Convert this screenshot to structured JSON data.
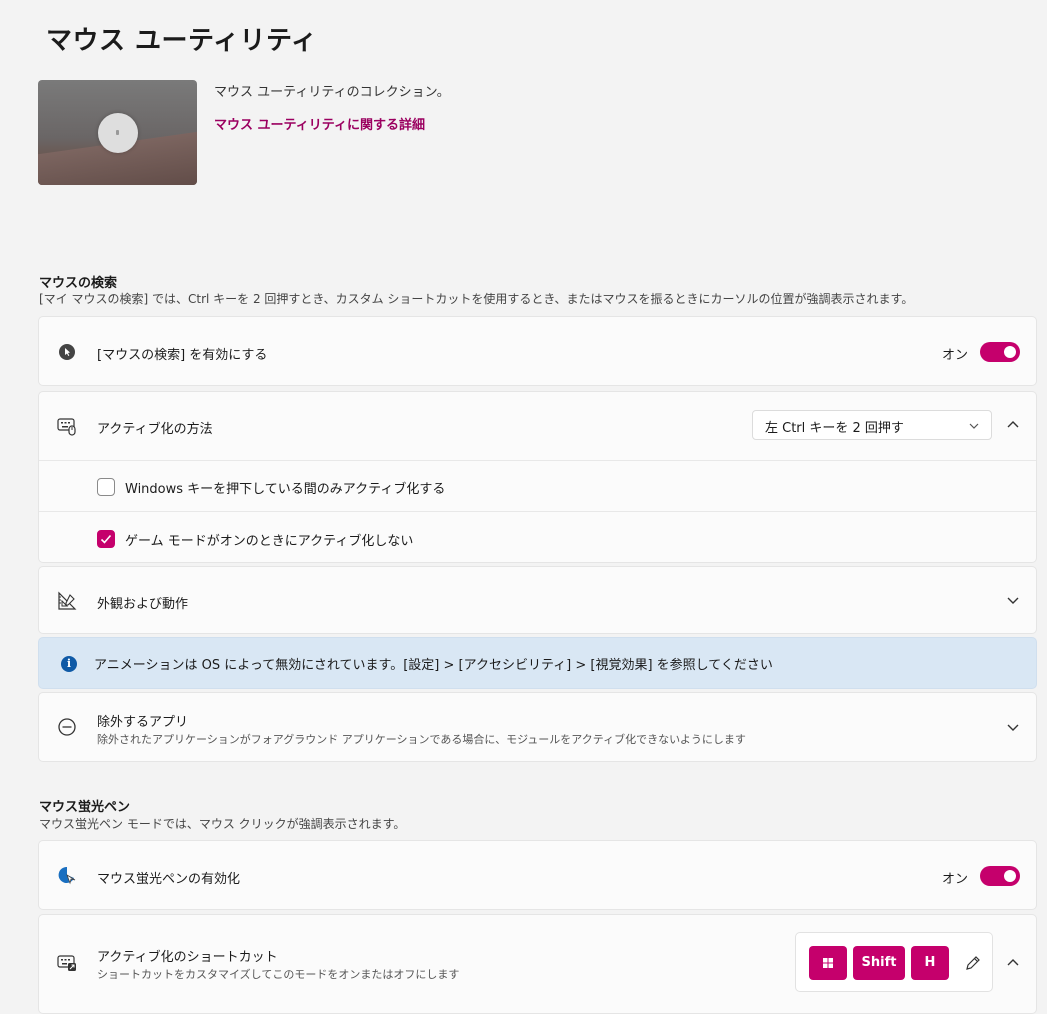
{
  "page": {
    "title": "マウス ユーティリティ"
  },
  "hero": {
    "description": "マウス ユーティリティのコレクション。",
    "link": "マウス ユーティリティに関する詳細"
  },
  "find_mouse": {
    "section_title": "マウスの検索",
    "section_desc": "[マイ マウスの検索] では、Ctrl キーを 2 回押すとき、カスタム ショートカットを使用するとき、またはマウスを振るときにカーソルの位置が強調表示されます。",
    "enable_label": "[マウスの検索] を有効にする",
    "enable_state": "オン",
    "activation_label": "アクティブ化の方法",
    "activation_value": "左 Ctrl キーを 2 回押す",
    "checkbox_windows": "Windows キーを押下している間のみアクティブ化する",
    "checkbox_windows_checked": false,
    "checkbox_game": "ゲーム モードがオンのときにアクティブ化しない",
    "checkbox_game_checked": true,
    "appearance_label": "外観および動作",
    "info_text": "アニメーションは OS によって無効にされています。[設定] > [アクセシビリティ] > [視覚効果] を参照してください",
    "excluded_label": "除外するアプリ",
    "excluded_desc": "除外されたアプリケーションがフォアグラウンド アプリケーションである場合に、モジュールをアクティブ化できないようにします"
  },
  "highlighter": {
    "section_title": "マウス蛍光ペン",
    "section_desc": "マウス蛍光ペン モードでは、マウス クリックが強調表示されます。",
    "enable_label": "マウス蛍光ペンの有効化",
    "enable_state": "オン",
    "shortcut_label": "アクティブ化のショートカット",
    "shortcut_desc": "ショートカットをカスタマイズしてこのモードをオンまたはオフにします",
    "keys": [
      "Shift",
      "H"
    ]
  },
  "colors": {
    "accent": "#c5006c",
    "link": "#9b0060",
    "info_bg": "#d9e7f4"
  }
}
